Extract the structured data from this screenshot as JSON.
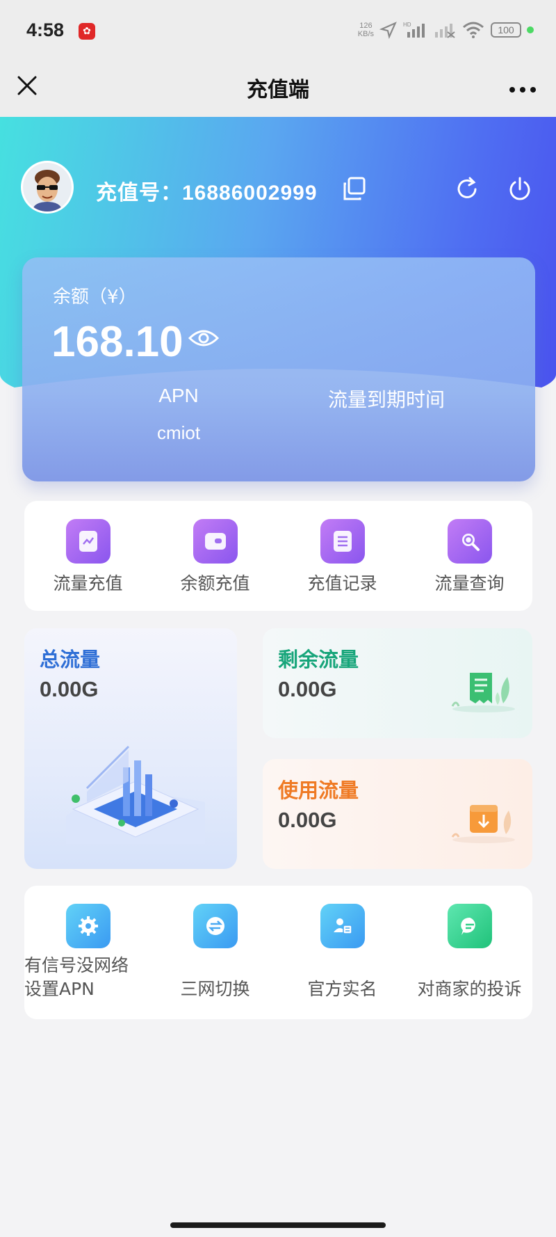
{
  "status": {
    "time": "4:58",
    "net_speed_value": "126",
    "net_speed_unit": "KB/s",
    "battery": "100",
    "icons": [
      "app-notification-icon",
      "location-icon",
      "signal-hd-icon",
      "signal-icon",
      "wifi-icon",
      "battery-icon"
    ]
  },
  "nav": {
    "title": "充值端",
    "close_icon": "close-icon",
    "more_icon": "more-icon"
  },
  "user": {
    "label": "充值号：16886002999",
    "icons": [
      "copy-icon",
      "refresh-icon",
      "power-icon"
    ]
  },
  "balance": {
    "label": "余额（¥）",
    "value": "168.10",
    "apn_label": "APN",
    "apn_value": "cmiot",
    "expire_label": "流量到期时间"
  },
  "actions": [
    {
      "label": "流量充值",
      "icon": "data-recharge-icon"
    },
    {
      "label": "余额充值",
      "icon": "wallet-icon"
    },
    {
      "label": "充值记录",
      "icon": "record-icon"
    },
    {
      "label": "流量查询",
      "icon": "search-icon"
    }
  ],
  "stats": {
    "total": {
      "title": "总流量",
      "value": "0.00G"
    },
    "remaining": {
      "title": "剩余流量",
      "value": "0.00G"
    },
    "used": {
      "title": "使用流量",
      "value": "0.00G"
    }
  },
  "services": [
    {
      "label_line1": "有信号没网络",
      "label_line2": "设置APN",
      "icon": "settings-icon"
    },
    {
      "label_line1": "",
      "label_line2": "三网切换",
      "icon": "switch-icon"
    },
    {
      "label_line1": "",
      "label_line2": "官方实名",
      "icon": "id-card-icon"
    },
    {
      "label_line1": "",
      "label_line2": "对商家的投诉",
      "icon": "message-icon"
    }
  ],
  "colors": {
    "total_title": "#2f6fd6",
    "remaining_title": "#17a57a",
    "used_title": "#ef7a24"
  }
}
